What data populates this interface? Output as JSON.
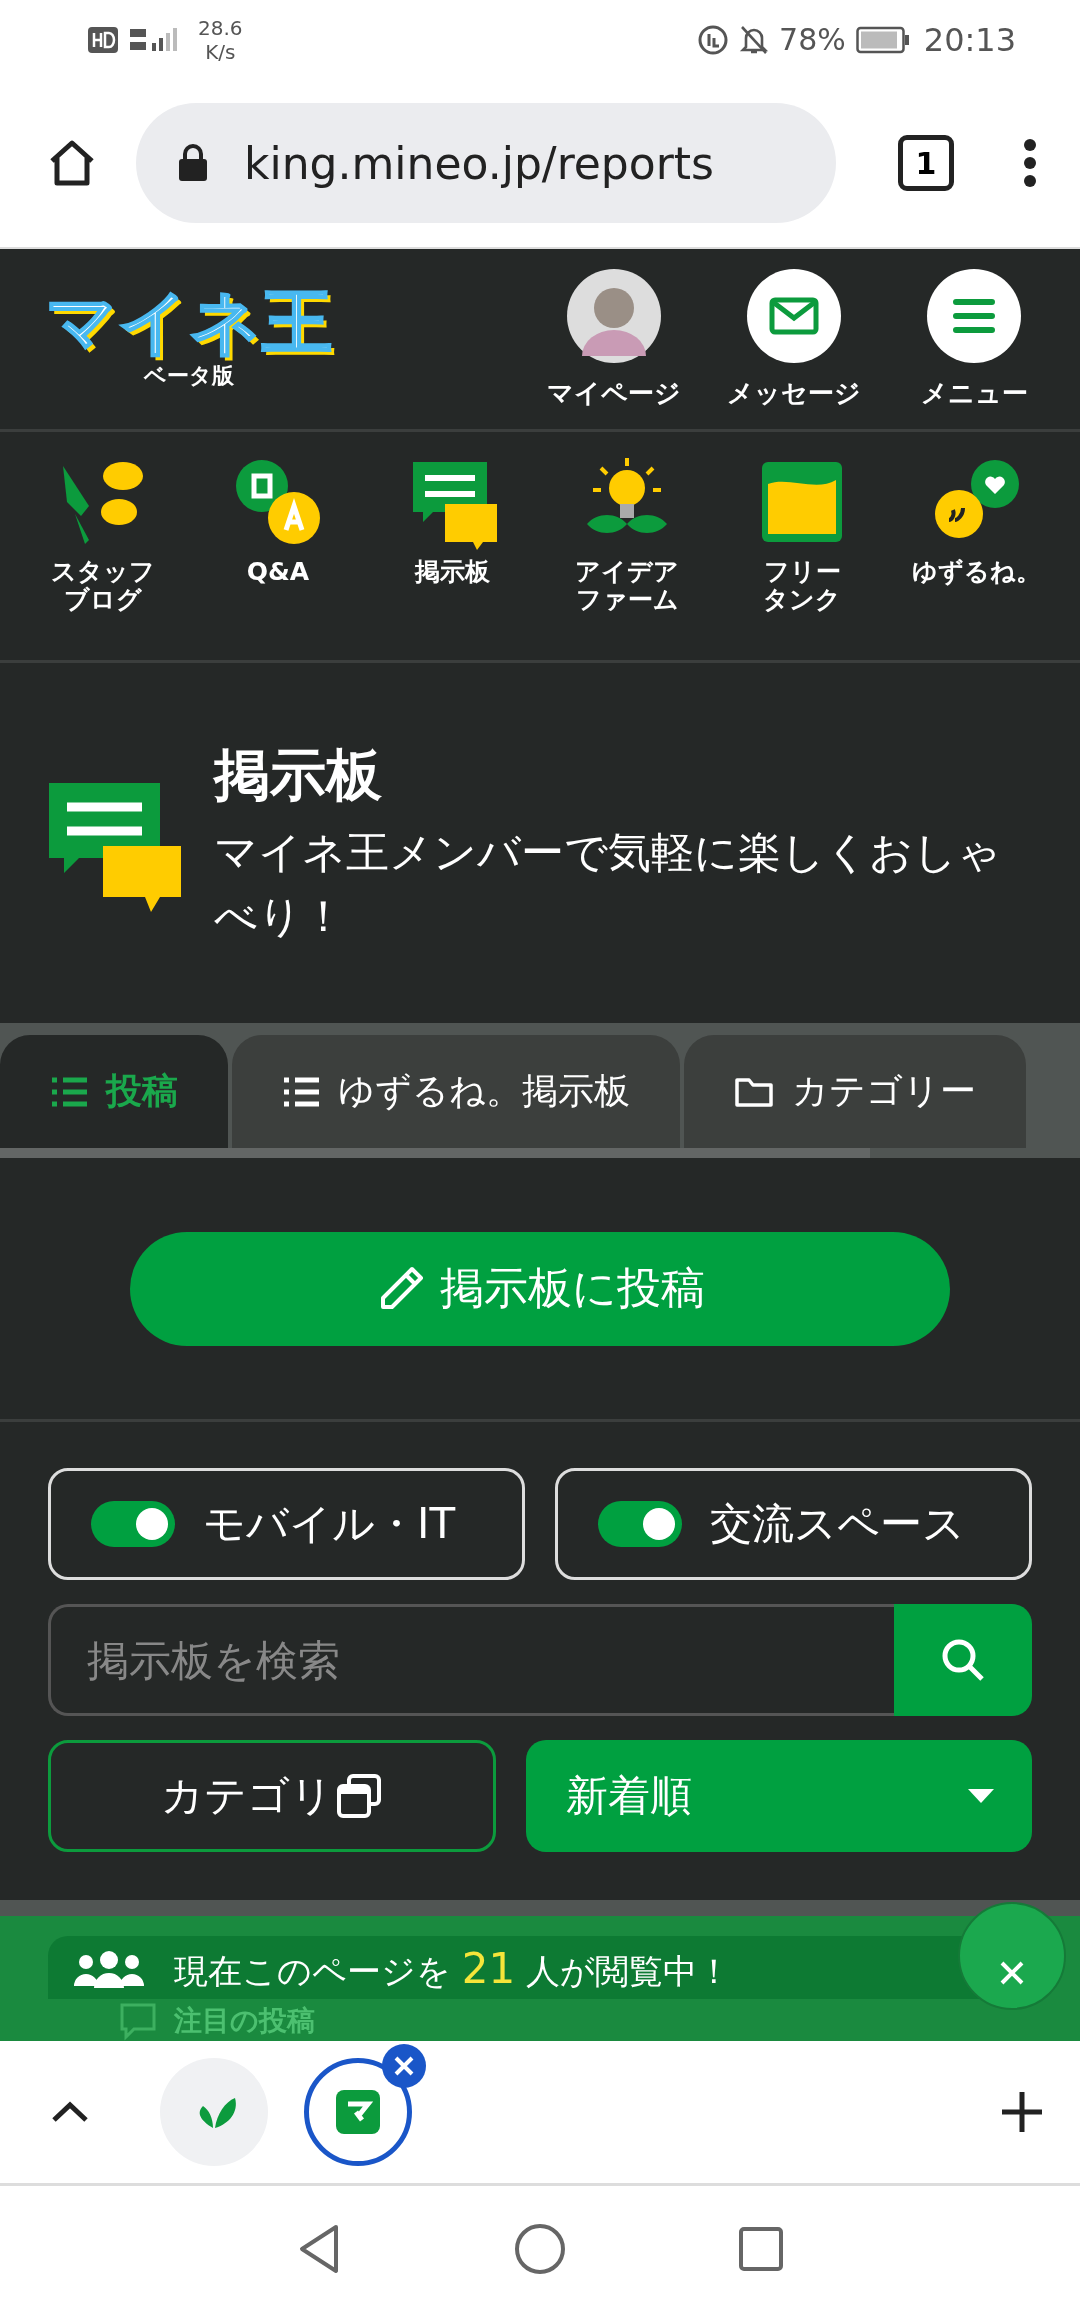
{
  "status_bar": {
    "network_speed": "28.6",
    "speed_unit": "K/s",
    "battery": "78%",
    "time": "20:13"
  },
  "browser": {
    "url": "king.mineo.jp/reports",
    "tab_count": "1"
  },
  "header": {
    "logo": "マイネ王",
    "logo_subtitle": "ベータ版",
    "actions": [
      {
        "kind": "avatar",
        "label": "マイページ"
      },
      {
        "kind": "mail",
        "label": "メッセージ"
      },
      {
        "kind": "menu",
        "label": "メニュー"
      }
    ]
  },
  "nav": [
    {
      "kind": "blog",
      "lines": [
        "スタッフ",
        "ブログ"
      ]
    },
    {
      "kind": "qa",
      "lines": [
        "Q&A"
      ]
    },
    {
      "kind": "board",
      "lines": [
        "掲示板"
      ]
    },
    {
      "kind": "idea",
      "lines": [
        "アイデア",
        "ファーム"
      ]
    },
    {
      "kind": "tank",
      "lines": [
        "フリー",
        "タンク"
      ]
    },
    {
      "kind": "yuzurune",
      "lines": [
        "ゆずるね。"
      ]
    }
  ],
  "hero": {
    "title": "掲示板",
    "description": "マイネ王メンバーで気軽に楽しくおしゃべり！"
  },
  "tabs": [
    {
      "kind": "list",
      "label": "投稿",
      "selected": true
    },
    {
      "kind": "list",
      "label": "ゆずるね。掲示板",
      "selected": false
    },
    {
      "kind": "folder",
      "label": "カテゴリー",
      "selected": false
    }
  ],
  "post_button": "掲示板に投稿",
  "filters": [
    {
      "label": "モバイル・IT",
      "on": true
    },
    {
      "label": "交流スペース",
      "on": true
    }
  ],
  "search": {
    "placeholder": "掲示板を検索"
  },
  "category_button": "カテゴリ",
  "sort": {
    "value": "新着順"
  },
  "viewers": {
    "prefix": "現在このページを",
    "count": "21",
    "suffix": "人が閲覧中！"
  },
  "featured": {
    "title": "注目の投稿"
  },
  "tab_strip": [
    {
      "kind": "yuzurune",
      "selected": false
    },
    {
      "kind": "mineo",
      "selected": true
    }
  ]
}
